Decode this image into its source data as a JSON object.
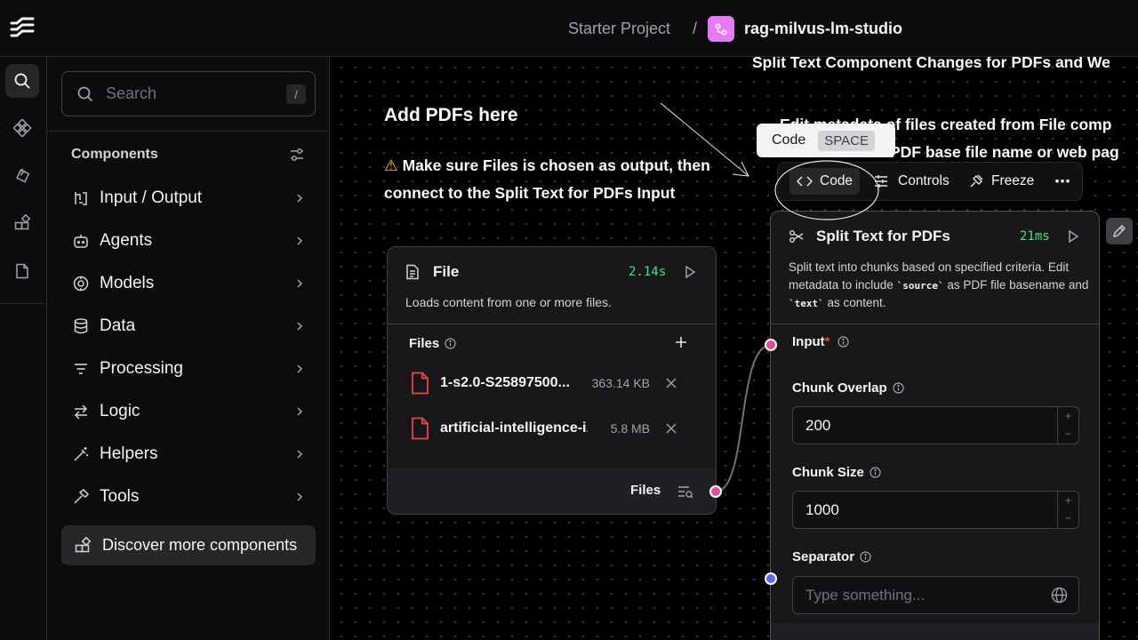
{
  "header": {
    "project": "Starter Project",
    "separator": "/",
    "flow_name": "rag-milvus-lm-studio"
  },
  "rail": {
    "icons": [
      "search-icon",
      "components-icon",
      "bundles-icon",
      "apps-icon",
      "file-icon"
    ]
  },
  "sidebar": {
    "search_placeholder": "Search",
    "search_shortcut": "/",
    "title": "Components",
    "categories": [
      {
        "label": "Input / Output",
        "icon": "input-output-icon"
      },
      {
        "label": "Agents",
        "icon": "bot-icon"
      },
      {
        "label": "Models",
        "icon": "brain-icon"
      },
      {
        "label": "Data",
        "icon": "database-icon"
      },
      {
        "label": "Processing",
        "icon": "filter-icon"
      },
      {
        "label": "Logic",
        "icon": "arrows-icon"
      },
      {
        "label": "Helpers",
        "icon": "wand-icon"
      },
      {
        "label": "Tools",
        "icon": "hammer-icon"
      }
    ],
    "discover_label": "Discover more components"
  },
  "canvas": {
    "note1": {
      "title": "Add PDFs here",
      "body": "Make sure Files is chosen as output, then connect to the Split Text for PDFs Input"
    },
    "note2": {
      "title": "Split Text Component Changes for PDFs and We",
      "line1": "Edit metadata of files created from File comp",
      "line2": "PDF base file name or web pag"
    },
    "tooltip": {
      "label": "Code",
      "shortcut": "SPACE"
    },
    "toolbar": {
      "code": "Code",
      "controls": "Controls",
      "freeze": "Freeze"
    },
    "file_node": {
      "title": "File",
      "runtime": "2.14s",
      "description": "Loads content from one or more files.",
      "files_label": "Files",
      "files": [
        {
          "name": "1-s2.0-S25897500...",
          "size": "363.14 KB"
        },
        {
          "name": "artificial-intelligence-i...",
          "size": "5.8 MB"
        }
      ],
      "output_label": "Files"
    },
    "split_node": {
      "title": "Split Text for PDFs",
      "runtime": "21ms",
      "description_1": "Split text into chunks based on specified criteria.",
      "description_2": "Edit metadata to include ",
      "description_code_1": "`source`",
      "description_3": " as PDF file basename and ",
      "description_code_2": "`text`",
      "description_4": " as content.",
      "input_label": "Input",
      "required_mark": "*",
      "chunk_overlap_label": "Chunk Overlap",
      "chunk_overlap_value": "200",
      "chunk_size_label": "Chunk Size",
      "chunk_size_value": "1000",
      "separator_label": "Separator",
      "separator_placeholder": "Type something..."
    }
  },
  "colors": {
    "accent_pink": "#ec4899",
    "accent_blue": "#6366f1",
    "runtime_green": "#4ade80",
    "flow_icon_bg": "#e879f9"
  }
}
